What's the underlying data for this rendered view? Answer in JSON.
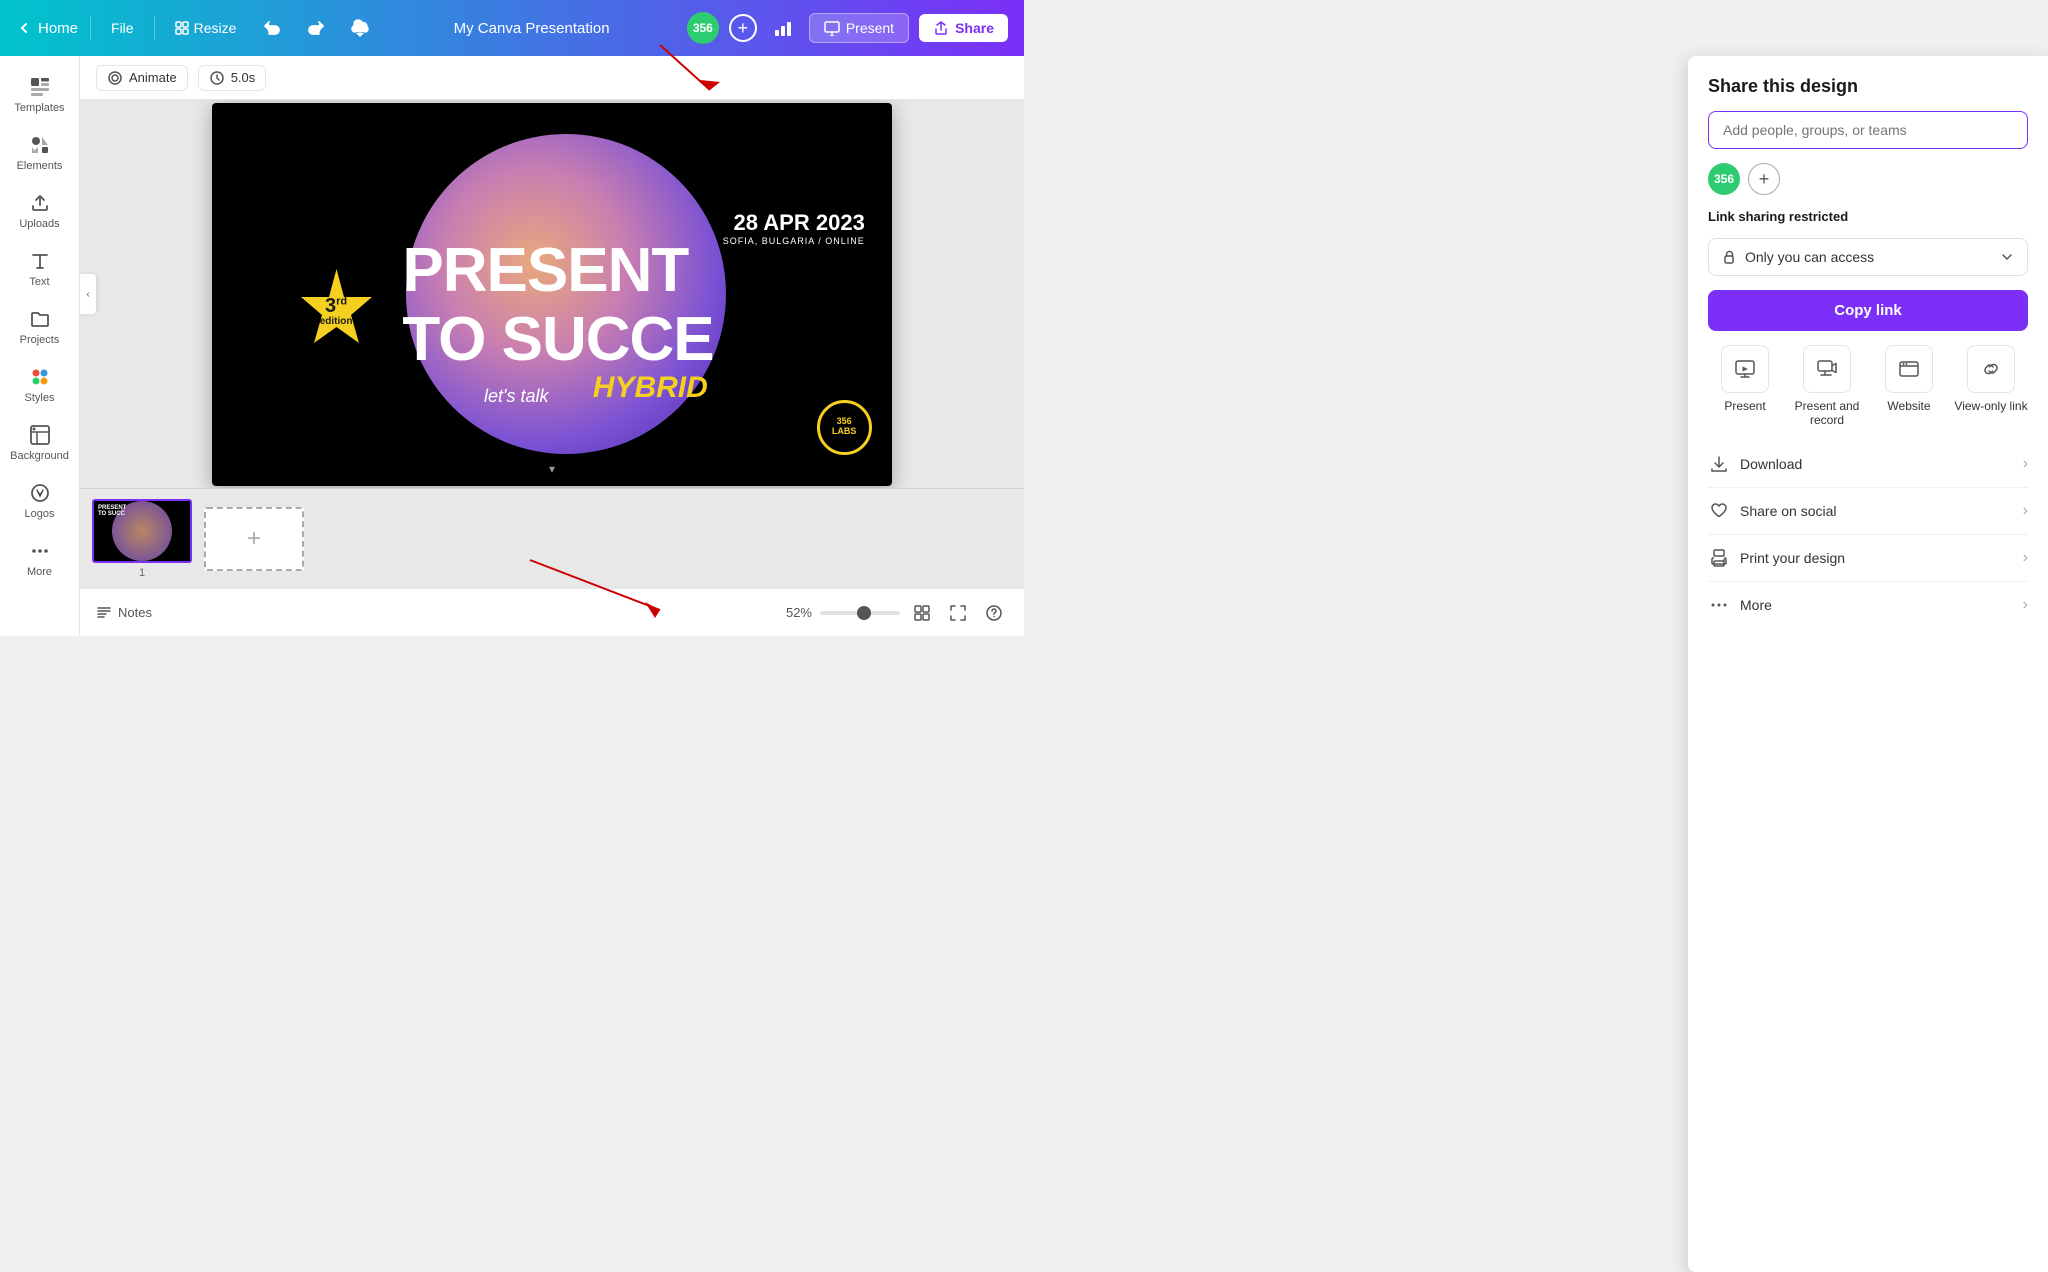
{
  "app": {
    "title": "My Canva Presentation"
  },
  "topnav": {
    "home_label": "Home",
    "file_label": "File",
    "resize_label": "Resize",
    "present_label": "Present",
    "share_label": "Share"
  },
  "toolbar": {
    "animate_label": "Animate",
    "duration_label": "5.0s"
  },
  "sidebar": {
    "items": [
      {
        "id": "templates",
        "label": "Templates"
      },
      {
        "id": "elements",
        "label": "Elements"
      },
      {
        "id": "uploads",
        "label": "Uploads"
      },
      {
        "id": "text",
        "label": "Text"
      },
      {
        "id": "projects",
        "label": "Projects"
      },
      {
        "id": "styles",
        "label": "Styles"
      },
      {
        "id": "background",
        "label": "Background"
      },
      {
        "id": "logos",
        "label": "Logos"
      },
      {
        "id": "more",
        "label": "More"
      }
    ]
  },
  "share_panel": {
    "title": "Share this design",
    "input_placeholder": "Add people, groups, or teams",
    "link_sharing_label": "Link sharing restricted",
    "access_option": "Only you can access",
    "copy_link_label": "Copy link",
    "options": [
      {
        "id": "present",
        "label": "Present"
      },
      {
        "id": "present-record",
        "label": "Present and record"
      },
      {
        "id": "website",
        "label": "Website"
      },
      {
        "id": "view-only",
        "label": "View-only link"
      }
    ],
    "menu_items": [
      {
        "id": "download",
        "label": "Download"
      },
      {
        "id": "share-social",
        "label": "Share on social"
      },
      {
        "id": "print",
        "label": "Print your design"
      },
      {
        "id": "more",
        "label": "More"
      }
    ]
  },
  "slide": {
    "text_present": "PRESENT",
    "text_succeed": "TO SUCCE",
    "text_lets": "let's talk",
    "text_hybrid": "HYBRID",
    "date": "28 APR 2023",
    "location": "SOFIA, BULGARIA / ONLINE",
    "edition_super": "rd",
    "edition_num": "3",
    "edition_text": "edition"
  },
  "bottom": {
    "notes_label": "Notes",
    "zoom_label": "52%",
    "slide_num": "1"
  }
}
